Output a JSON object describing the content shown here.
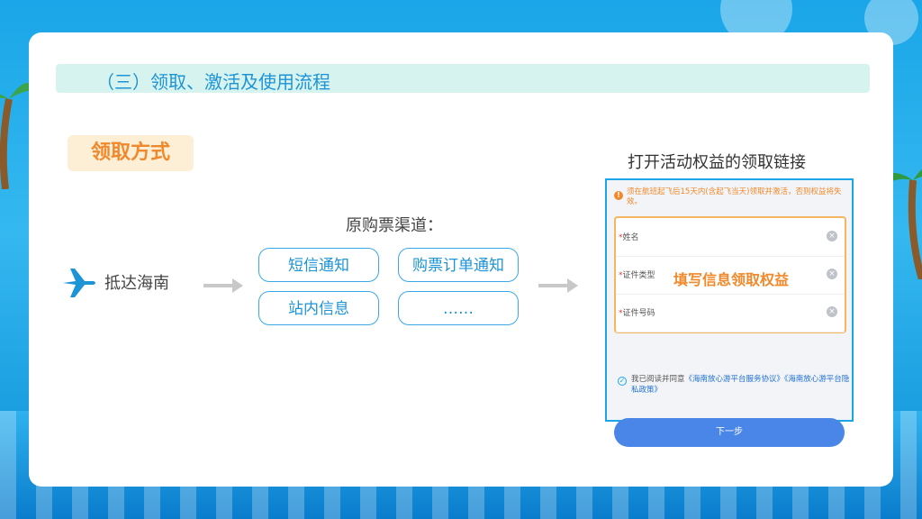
{
  "section": {
    "title": "（三）领取、激活及使用流程"
  },
  "method": {
    "tag": "领取方式"
  },
  "flow": {
    "start_label": "抵达海南",
    "channels_title": "原购票渠道：",
    "channels": [
      "短信通知",
      "购票订单通知",
      "站内信息",
      "……"
    ],
    "link_title": "打开活动权益的领取链接"
  },
  "phone": {
    "notice": "须在航班起飞后15天内(含起飞当天)领取并激活，否则权益将失效。",
    "fields": [
      {
        "required": "*",
        "label": "姓名"
      },
      {
        "required": "*",
        "label": "证件类型"
      },
      {
        "required": "*",
        "label": "证件号码"
      }
    ],
    "overlay": "填写信息领取权益",
    "agreement": {
      "prefix": "我已阅读并同意",
      "link1": "《海南放心游平台服务协议》",
      "link2": "《海南放心游平台隐私政策》"
    },
    "next_button": "下一步"
  },
  "colors": {
    "accent": "#1d94d6",
    "orange": "#f0892b",
    "button": "#4a86e8"
  },
  "icons": [
    "airplane-icon",
    "arrow-right-icon",
    "alert-icon",
    "clear-icon",
    "check-circle-icon"
  ]
}
